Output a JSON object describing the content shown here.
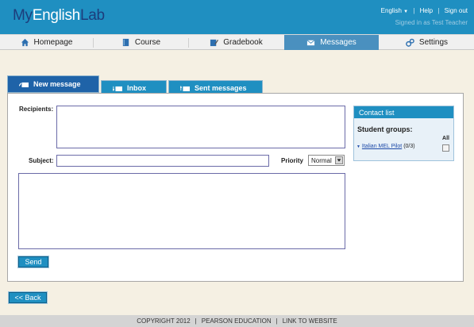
{
  "brand": {
    "logo_part1": "My",
    "logo_part2": "English",
    "logo_part3": "Lab"
  },
  "toplinks": {
    "language": "English",
    "help": "Help",
    "signout": "Sign out",
    "signed_in": "Signed in as Test Teacher"
  },
  "nav": {
    "items": [
      {
        "label": "Homepage",
        "icon": "home-icon"
      },
      {
        "label": "Course",
        "icon": "book-icon"
      },
      {
        "label": "Gradebook",
        "icon": "gradebook-icon"
      },
      {
        "label": "Messages",
        "icon": "envelope-icon",
        "active": true
      },
      {
        "label": "Settings",
        "icon": "gears-icon"
      }
    ]
  },
  "tabs": {
    "new_message": "New message",
    "inbox": "Inbox",
    "sent": "Sent messages"
  },
  "form": {
    "recipients_label": "Recipients:",
    "subject_label": "Subject:",
    "priority_label": "Priority",
    "priority_value": "Normal",
    "send_label": "Send"
  },
  "contacts": {
    "title": "Contact list",
    "student_groups": "Student groups:",
    "all_label": "All",
    "group_name": "Italian MEL Pilot",
    "group_count": "(0/3)"
  },
  "back_label": "<< Back",
  "footer": {
    "copyright": "COPYRIGHT 2012",
    "company": "PEARSON EDUCATION",
    "link": "LINK TO WEBSITE"
  },
  "colors": {
    "header": "#1f8fc1",
    "active_tab": "#1f63a8",
    "nav_active": "#4a90bf",
    "page_bg": "#f5f0e3"
  }
}
